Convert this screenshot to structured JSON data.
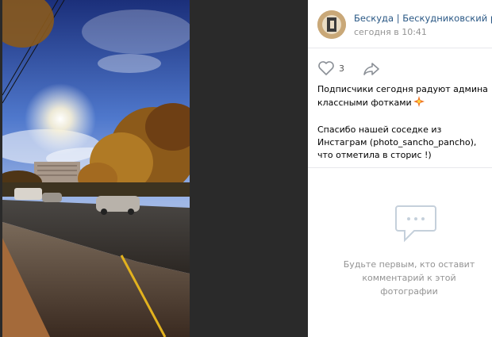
{
  "post": {
    "author_name": "Бескуда | Бескудниковский район",
    "time": "сегодня в 10:41",
    "likes": "3",
    "caption_line1": "Подписчики сегодня радуют админа классными фотками",
    "caption_line2": "Спасибо нашей соседке из Инстаграм (photo_sancho_pancho), что отметила в сторис !)"
  },
  "comments": {
    "empty_text": "Будьте первым, кто оставит комментарий к этой фотографии"
  },
  "icons": {
    "like": "heart-icon",
    "share": "share-arrow-icon",
    "comments": "speech-bubble-icon",
    "emoji": "sparkle-emoji-icon"
  },
  "colors": {
    "link": "#2a5885",
    "muted": "#939393",
    "viewer_bg": "#2a2a2a"
  }
}
